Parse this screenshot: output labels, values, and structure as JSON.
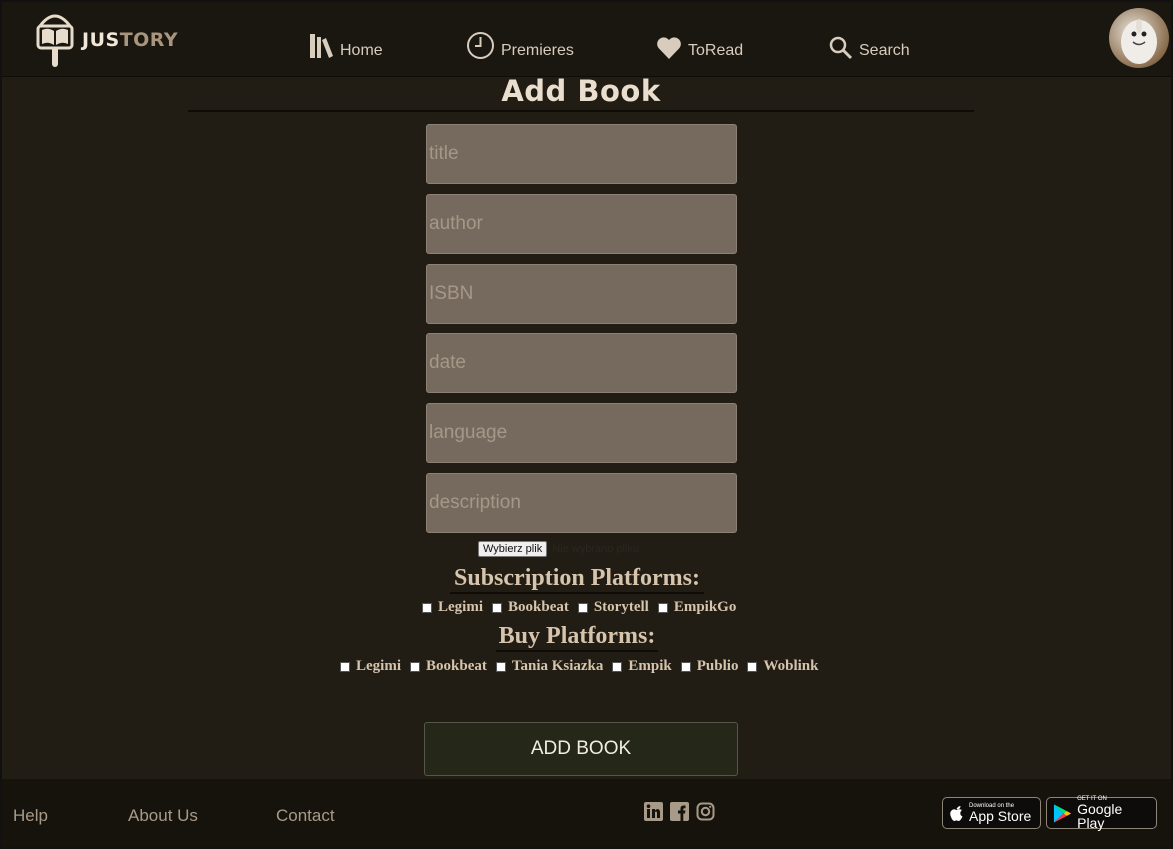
{
  "header": {
    "logo_text_a": "JUS",
    "logo_text_b": "TORY",
    "nav": [
      {
        "label": "Home",
        "icon": "books-icon"
      },
      {
        "label": "Premieres",
        "icon": "clock-icon"
      },
      {
        "label": "ToRead",
        "icon": "heart-icon"
      },
      {
        "label": "Search",
        "icon": "search-icon"
      }
    ]
  },
  "form": {
    "title": "Add Book",
    "fields": [
      {
        "placeholder": "title",
        "value": ""
      },
      {
        "placeholder": "author",
        "value": ""
      },
      {
        "placeholder": "ISBN",
        "value": ""
      },
      {
        "placeholder": "date",
        "value": ""
      },
      {
        "placeholder": "language",
        "value": ""
      },
      {
        "placeholder": "description",
        "value": ""
      }
    ],
    "file_button": "Wybierz plik",
    "file_status": "Nie wybrano pliku",
    "subscription_title": "Subscription Platforms:",
    "subscription_platforms": [
      "Legimi",
      "Bookbeat",
      "Storytell",
      "EmpikGo"
    ],
    "buy_title": "Buy Platforms:",
    "buy_platforms": [
      "Legimi",
      "Bookbeat",
      "Tania Ksiazka",
      "Empik",
      "Publio",
      "Woblink"
    ],
    "submit_label": "ADD BOOK"
  },
  "footer": {
    "links": [
      "Help",
      "About Us",
      "Contact"
    ],
    "social_icons": [
      "linkedin-icon",
      "facebook-icon",
      "instagram-icon"
    ],
    "app_store": {
      "small": "Download on the",
      "big": "App Store"
    },
    "google_play": {
      "small": "GET IT ON",
      "big": "Google Play"
    }
  },
  "colors": {
    "background": "#221d14",
    "header": "#1a1610",
    "input": "#766a5e",
    "text": "#d8ccbc",
    "button": "#252818"
  }
}
